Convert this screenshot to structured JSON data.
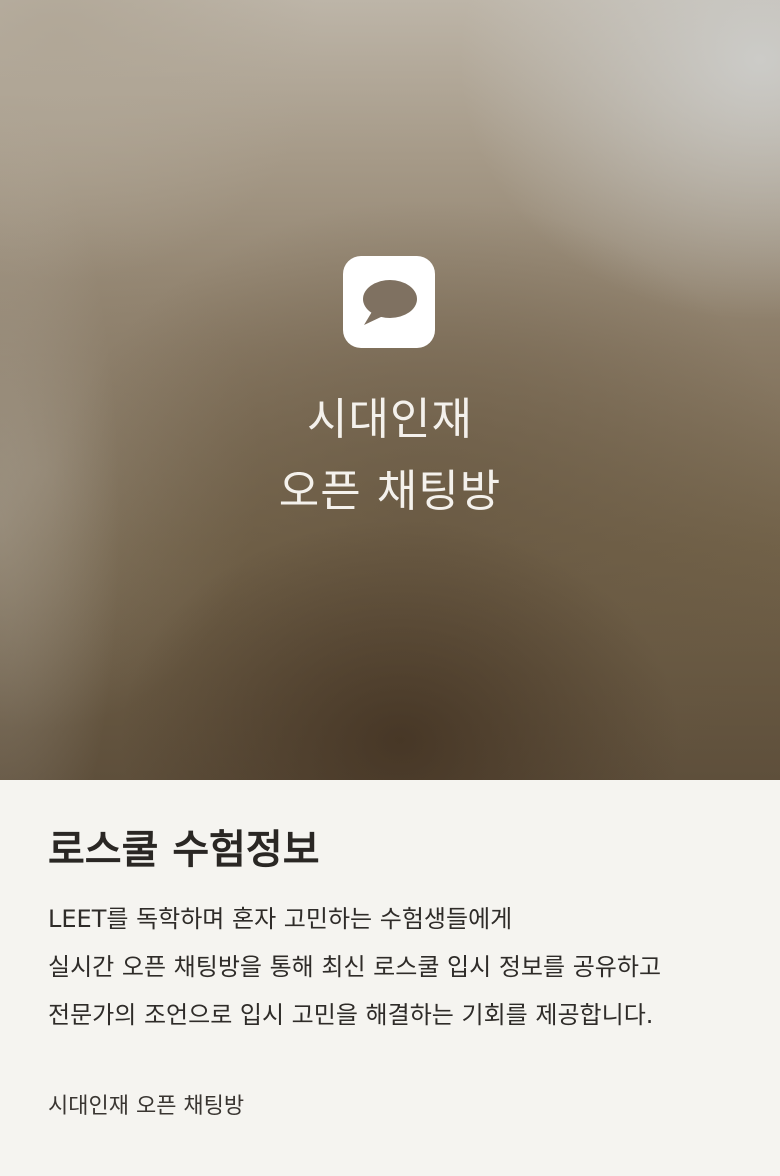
{
  "hero": {
    "icon": "chat-bubble-icon",
    "title_line1": "시대인재",
    "title_line2": "오픈 채팅방"
  },
  "content": {
    "title": "로스쿨 수험정보",
    "description_lines": [
      "LEET를 독학하며 혼자 고민하는 수험생들에게",
      "실시간 오픈 채팅방을 통해 최신 로스쿨 입시 정보를 공유하고",
      "전문가의 조언으로 입시 고민을 해결하는 기회를 제공합니다."
    ],
    "source": "시대인재 오픈 채팅방"
  },
  "colors": {
    "background": "#f5f4f0",
    "icon_tile": "#ffffff",
    "icon_bubble": "#7f7161",
    "hero_text": "#f4f1ec",
    "title_text": "#2a2724"
  }
}
